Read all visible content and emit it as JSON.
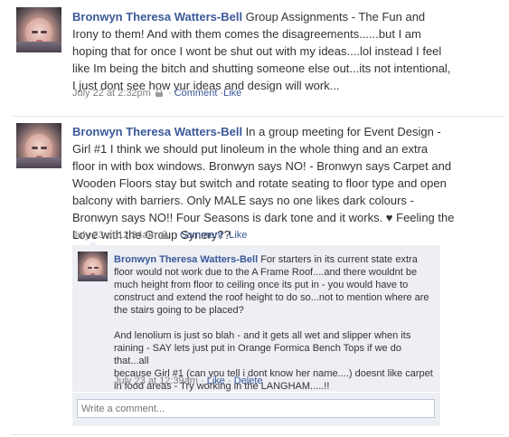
{
  "posts": [
    {
      "author": "Bronwyn Theresa Watters-Bell",
      "lines": [
        " Group Assignments - The Fun and",
        "Irony to them! And with them comes the disagreements......but I am",
        "hoping that for once I wont be shut out with my ideas....lol instead I feel",
        "like Im being the bitch and shutting someone else out...its not intentional,",
        "I just dont see how yur ideas and design will work..."
      ],
      "timestamp": "July 22 at 2:32pm",
      "comment_label": "Comment",
      "like_label": "Like",
      "separator": "·"
    },
    {
      "author": "Bronwyn Theresa Watters-Bell",
      "lines": [
        " In a group meeting for Event Design -",
        "Girl #1 I think we should put linoleum in the whole thing and an extra",
        "floor in with box windows. Bronwyn says NO! - Bronwyn says Carpet and",
        "Wooden Floors stay but switch and rotate seating to floor type and open",
        "balcony with barriers. Only MALE says no one likes dark colours -",
        "Bronwyn says NO!! Four Seasons is dark tone and it works. ♥ Feeling the",
        "Love with the Group Synery??"
      ],
      "timestamp": "July 23 at 12:34am",
      "comment_label": "Comment",
      "like_label": "Like",
      "separator": "·"
    }
  ],
  "comment": {
    "author": "Bronwyn Theresa Watters-Bell",
    "paragraph1": [
      " For starters in its current state extra",
      "floor would not work due to the A Frame Roof....and there wouldnt be",
      "much height from floor to ceiling once its put in - you would have to",
      "construct and extend the roof height to do so...not to mention where are",
      "the stairs going to be placed?"
    ],
    "paragraph2": [
      "And lenolium is just so blah - and it gets all wet and slipper when its",
      "raining - SAY lets just put in Orange Formica Bench Tops if we do that...all",
      "because Girl #1 (can you tell i dont know her name....) doesnt like carpet",
      "in food areas - Try working in the LANGHAM.....!!"
    ],
    "timestamp": "July 23 at 12:39am",
    "like_label": "Like",
    "delete_label": "Delete",
    "separator": "·"
  },
  "comment_input": {
    "placeholder": "Write a comment..."
  },
  "colors": {
    "link": "#3b5998",
    "meta": "#808080",
    "comment_bg": "#edeff4"
  }
}
